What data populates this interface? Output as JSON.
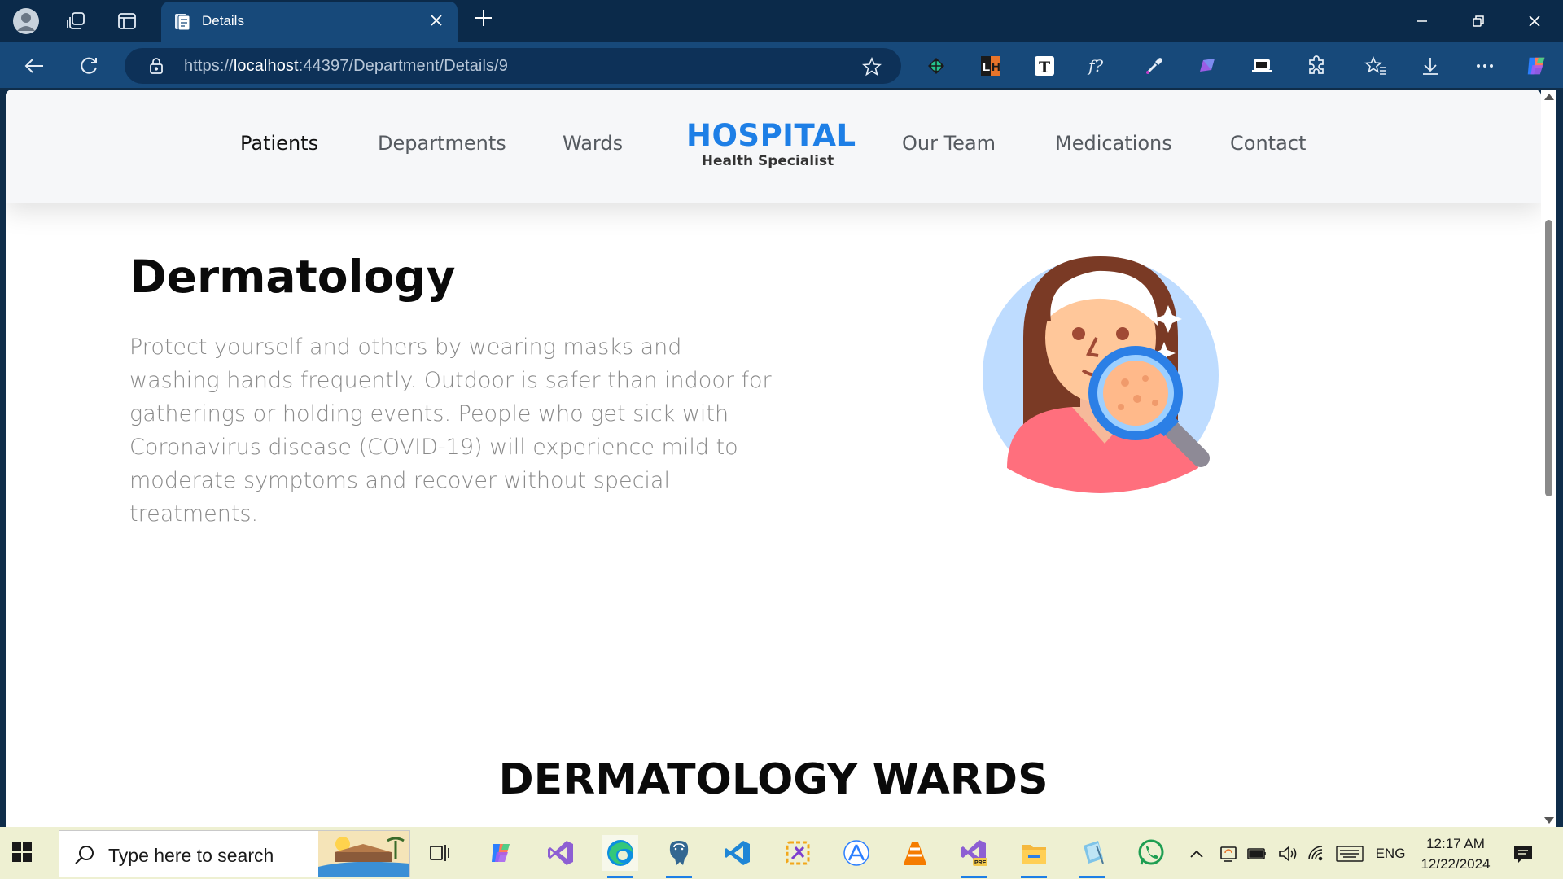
{
  "browser": {
    "tab_title": "Details",
    "url_prefix": "https://",
    "url_host": "localhost",
    "url_rest": ":44397/Department/Details/9",
    "extensions": [
      "color-palette-ext",
      "lighthouse-ext",
      "text-ext",
      "formula-ext",
      "color-picker-ext",
      "pen-ext",
      "screen-cast-ext"
    ],
    "ext_labels": {
      "lighthouse": "LH",
      "text": "T",
      "formula": "f?"
    }
  },
  "site": {
    "nav_left": [
      "Patients",
      "Departments",
      "Wards"
    ],
    "nav_right": [
      "Our Team",
      "Medications",
      "Contact"
    ],
    "brand_name": "HOSPITAL",
    "brand_tagline": "Health Specialist",
    "accent_color": "#1e7fe6"
  },
  "department": {
    "name": "Dermatology",
    "description": "Protect yourself and others by wearing masks and washing hands frequently. Outdoor is safer than indoor for gatherings or holding events. People who get sick with Coronavirus disease (COVID-19) will experience mild to moderate symptoms and recover without special treatments.",
    "wards_heading": "DERMATOLOGY WARDS"
  },
  "taskbar": {
    "search_placeholder": "Type here to search",
    "language": "ENG",
    "time": "12:17 AM",
    "date": "12/22/2024",
    "apps": [
      "task-view",
      "copilot",
      "visual-studio",
      "edge",
      "postgresql",
      "vscode",
      "snip-tool",
      "app-store",
      "vlc",
      "visual-studio-preview",
      "file-explorer",
      "notepad",
      "whatsapp"
    ]
  }
}
